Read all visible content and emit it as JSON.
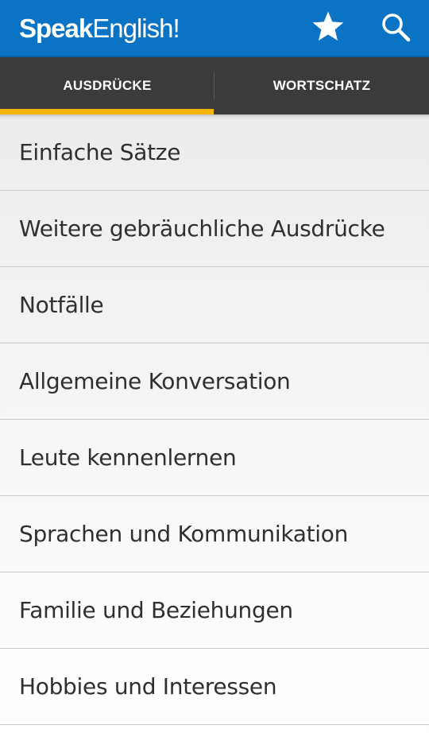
{
  "app": {
    "brand_part1": "Speak",
    "brand_part2": "English!",
    "accent_color": "#0a73c4",
    "icons": [
      "star-icon",
      "search-icon"
    ]
  },
  "tabs": [
    {
      "label": "AUSDRÜCKE",
      "selected": true
    },
    {
      "label": "WORTSCHATZ",
      "selected": false
    }
  ],
  "tab_indicator_color": "#f5b400",
  "list": {
    "items": [
      {
        "label": "Einfache Sätze"
      },
      {
        "label": "Weitere gebräuchliche Ausdrücke"
      },
      {
        "label": "Notfälle"
      },
      {
        "label": "Allgemeine Konversation"
      },
      {
        "label": "Leute kennenlernen"
      },
      {
        "label": "Sprachen und Kommunikation"
      },
      {
        "label": "Familie und Beziehungen"
      },
      {
        "label": "Hobbies und Interessen"
      }
    ]
  }
}
